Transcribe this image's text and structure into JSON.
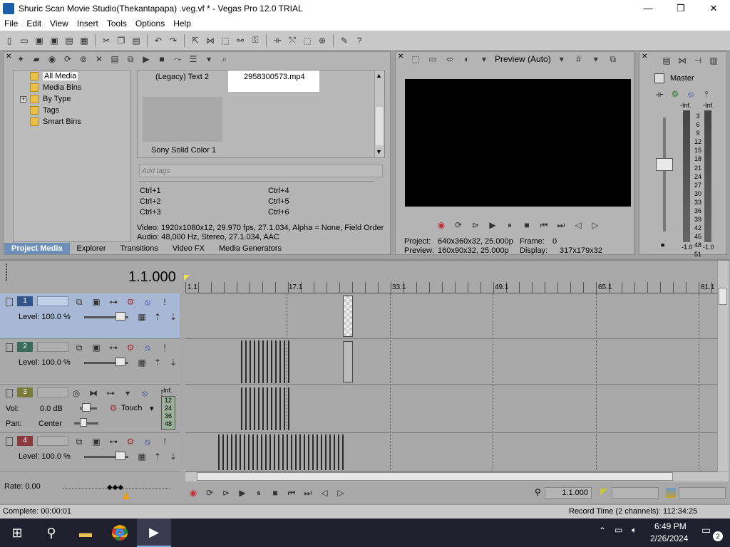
{
  "window": {
    "title": "Shuric Scan Movie Studio(Thekantapapa) .veg.vf * - Vegas Pro 12.0 TRIAL",
    "minimize": "—",
    "maximize": "❐",
    "close": "✕"
  },
  "menu": [
    "File",
    "Edit",
    "View",
    "Insert",
    "Tools",
    "Options",
    "Help"
  ],
  "explorer": {
    "items": [
      "All Media",
      "Media Bins",
      "By Type",
      "Tags",
      "Smart Bins"
    ],
    "expand": "+"
  },
  "media": {
    "items": [
      "(Legacy) Text 2",
      "2958300573.mp4",
      "Sony Solid Color 1"
    ],
    "tags_placeholder": "Add tags",
    "shortcuts": [
      "Ctrl+1",
      "Ctrl+4",
      "Ctrl+2",
      "Ctrl+5",
      "Ctrl+3",
      "Ctrl+6"
    ],
    "video_info": "Video: 1920x1080x12, 29.970 fps, 27.1.034, Alpha = None, Field Order",
    "audio_info": "Audio: 48,000 Hz, Stereo, 27.1.034, AAC"
  },
  "tabs": [
    "Project Media",
    "Explorer",
    "Transitions",
    "Video FX",
    "Media Generators"
  ],
  "preview": {
    "mode": "Preview (Auto)",
    "project_label": "Project:",
    "project_val": "640x360x32, 25.000p",
    "preview_label": "Preview:",
    "preview_val": "160x90x32, 25.000p",
    "frame_label": "Frame:",
    "frame_val": "0",
    "display_label": "Display:",
    "display_val": "317x179x32"
  },
  "mixer": {
    "title": "Master",
    "inf_left": "-Inf.",
    "inf_right": "-Inf.",
    "scale": [
      "3",
      "6",
      "9",
      "12",
      "15",
      "18",
      "21",
      "24",
      "27",
      "30",
      "33",
      "36",
      "39",
      "42",
      "45",
      "48",
      "51",
      "54",
      "57"
    ],
    "bottom_left": "-1.0",
    "bottom_right": "-1.0"
  },
  "timeline": {
    "time": "1.1.000",
    "ruler": [
      "1.1",
      "17.1",
      "33.1",
      "49.1",
      "65.1",
      "81.1"
    ],
    "tracks": [
      {
        "num": "1",
        "label": "Level: 100.0 %"
      },
      {
        "num": "2",
        "label": "Level: 100.0 %"
      },
      {
        "num": "3",
        "vol_label": "Vol:",
        "vol_val": "0.0 dB",
        "pan_label": "Pan:",
        "pan_val": "Center",
        "touch": "Touch",
        "inf": "-Inf.",
        "levels": [
          "12",
          "24",
          "36",
          "48"
        ]
      },
      {
        "num": "4",
        "label": "Level: 100.0 %"
      }
    ],
    "rate": "Rate: 0.00",
    "cursor_time": "1.1.000"
  },
  "status": {
    "left": "Complete: 00:00:01",
    "right": "Record Time (2 channels): 112:34:25"
  },
  "taskbar": {
    "time": "6:49 PM",
    "date": "2/26/2024",
    "notif": "2"
  }
}
